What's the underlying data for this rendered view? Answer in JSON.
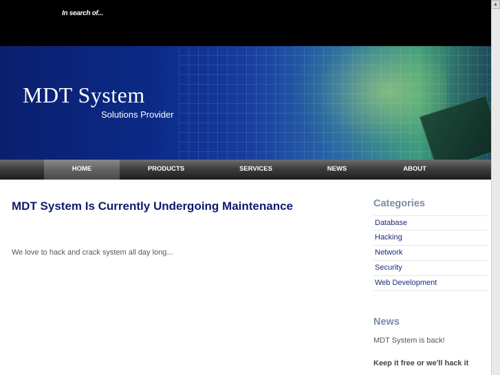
{
  "header": {
    "tagline": "In search of..."
  },
  "banner": {
    "title": "MDT System",
    "subtitle": "Solutions Provider"
  },
  "nav": {
    "items": [
      {
        "label": "HOME",
        "active": true
      },
      {
        "label": "PRODUCTS",
        "active": false
      },
      {
        "label": "SERVICES",
        "active": false
      },
      {
        "label": "NEWS",
        "active": false
      },
      {
        "label": "ABOUT",
        "active": false
      }
    ]
  },
  "main": {
    "title": "MDT System Is Currently Undergoing Maintenance",
    "body": "We love to hack and crack system all day long..."
  },
  "sidebar": {
    "categories_heading": "Categories",
    "categories": [
      "Database",
      "Hacking",
      "Network",
      "Security",
      "Web Development"
    ],
    "news_heading": "News",
    "news_items": [
      "MDT System is back!",
      "Keep it free or we'll hack it"
    ]
  },
  "icons": {
    "scroll_up": "scroll-up-arrow-icon"
  }
}
